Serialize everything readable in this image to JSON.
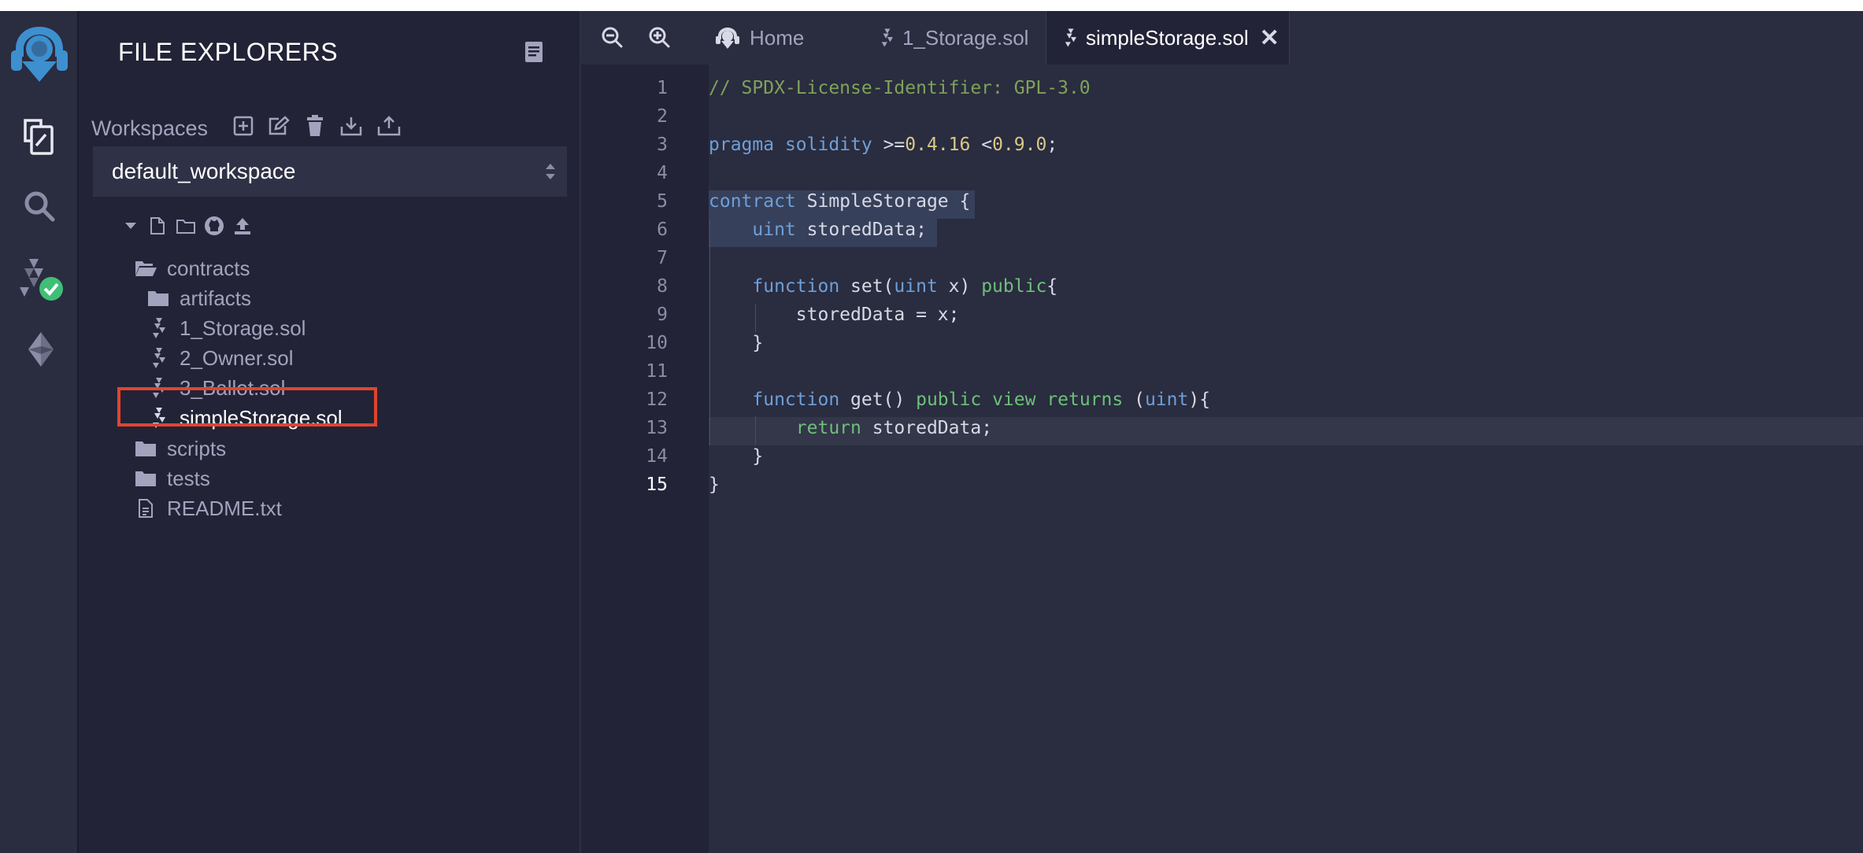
{
  "icons": {
    "logo": "remix-logo-icon",
    "file_explorer": "file-explorer-icon",
    "search": "search-icon",
    "compiler": "solidity-compiler-icon",
    "deploy": "ethereum-deploy-icon"
  },
  "explorer": {
    "title": "FILE EXPLORERS",
    "workspaces_label": "Workspaces",
    "workspace_selected": "default_workspace"
  },
  "tree": {
    "folders": {
      "contracts": "contracts",
      "artifacts": "artifacts",
      "scripts": "scripts",
      "tests": "tests"
    },
    "files": {
      "f1": "1_Storage.sol",
      "f2": "2_Owner.sol",
      "f3": "3_Ballot.sol",
      "f4": "simpleStorage.sol",
      "readme": "README.txt"
    }
  },
  "tabs": {
    "home": "Home",
    "storage": "1_Storage.sol",
    "active": "simpleStorage.sol"
  },
  "code": {
    "current_line": 15,
    "lines": [
      "// SPDX-License-Identifier: GPL-3.0",
      "",
      "pragma solidity >=0.4.16 <0.9.0;",
      "",
      "contract SimpleStorage {",
      "    uint storedData;",
      "",
      "    function set(uint x) public{",
      "        storedData = x;",
      "    }",
      "",
      "    function get() public view returns (uint){",
      "        return storedData;",
      "    }",
      "}"
    ]
  },
  "colors": {
    "comment": "#7ea35a",
    "keyword": "#6e9fd8",
    "green_keyword": "#6cc07a",
    "number": "#d7c989",
    "highlight_box": "#e0442f"
  }
}
